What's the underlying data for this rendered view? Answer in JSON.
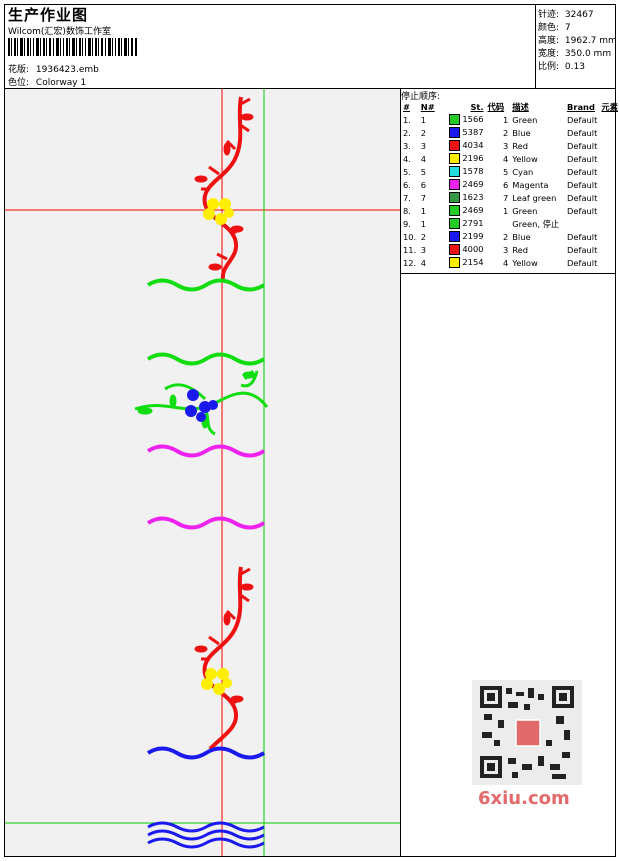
{
  "header": {
    "title": "生产作业图",
    "company": "Wilcom(汇宏)数饰工作室",
    "design_label": "花版:",
    "design_value": "1936423.emb",
    "colorway_label": "色位:",
    "colorway_value": "Colorway 1"
  },
  "stats": [
    {
      "label": "针迹:",
      "value": "32467"
    },
    {
      "label": "颜色:",
      "value": "7"
    },
    {
      "label": "高度:",
      "value": "1962.7 mm"
    },
    {
      "label": "宽度:",
      "value": "350.0 mm"
    },
    {
      "label": "比例:",
      "value": "0.13"
    }
  ],
  "stop_sequence": {
    "title": "停止顺序:",
    "headers": [
      "#",
      "N#",
      "St.",
      "代码",
      "描述",
      "Brand",
      "元素"
    ],
    "rows": [
      {
        "idx": "1.",
        "n": "1",
        "color": "#22cc22",
        "st": "1566",
        "code": "1",
        "desc": "Green",
        "brand": "Default"
      },
      {
        "idx": "2.",
        "n": "2",
        "color": "#1a1aee",
        "st": "5387",
        "code": "2",
        "desc": "Blue",
        "brand": "Default"
      },
      {
        "idx": "3.",
        "n": "3",
        "color": "#ee1111",
        "st": "4034",
        "code": "3",
        "desc": "Red",
        "brand": "Default"
      },
      {
        "idx": "4.",
        "n": "4",
        "color": "#ffee00",
        "st": "2196",
        "code": "4",
        "desc": "Yellow",
        "brand": "Default"
      },
      {
        "idx": "5.",
        "n": "5",
        "color": "#22dddd",
        "st": "1578",
        "code": "5",
        "desc": "Cyan",
        "brand": "Default"
      },
      {
        "idx": "6.",
        "n": "6",
        "color": "#ee22ee",
        "st": "2469",
        "code": "6",
        "desc": "Magenta",
        "brand": "Default"
      },
      {
        "idx": "7.",
        "n": "7",
        "color": "#339944",
        "st": "1623",
        "code": "7",
        "desc": "Leaf green",
        "brand": "Default"
      },
      {
        "idx": "8.",
        "n": "1",
        "color": "#22cc22",
        "st": "2469",
        "code": "1",
        "desc": "Green",
        "brand": "Default"
      },
      {
        "idx": "9.",
        "n": "1",
        "color": "#22cc22",
        "st": "2791",
        "code": "",
        "desc": "Green, 停止",
        "brand": ""
      },
      {
        "idx": "10.",
        "n": "2",
        "color": "#1a1aee",
        "st": "2199",
        "code": "2",
        "desc": "Blue",
        "brand": "Default"
      },
      {
        "idx": "11.",
        "n": "3",
        "color": "#ee1111",
        "st": "4000",
        "code": "3",
        "desc": "Red",
        "brand": "Default"
      },
      {
        "idx": "12.",
        "n": "4",
        "color": "#ffee00",
        "st": "2154",
        "code": "4",
        "desc": "Yellow",
        "brand": "Default"
      }
    ]
  },
  "watermark": "6xiu.com",
  "colors": {
    "guide_red": "#ff0000",
    "guide_green": "#00cc00",
    "red": "#ee1111",
    "green": "#11dd11",
    "blue": "#1a1aee",
    "magenta": "#ee22ee",
    "yellow": "#ffee00"
  }
}
